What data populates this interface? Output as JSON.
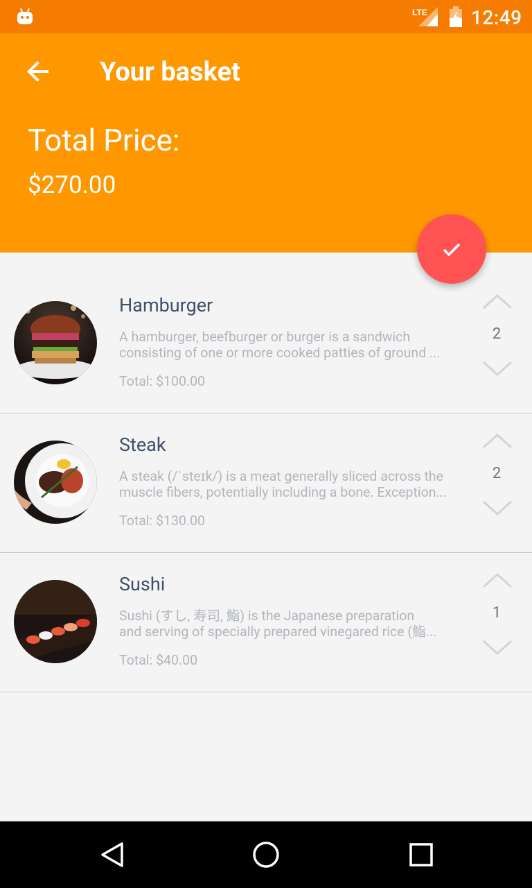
{
  "status_bar": {
    "time": "12:49",
    "network": "LTE",
    "icons": [
      "android-icon",
      "lte-signal-icon",
      "battery-icon"
    ]
  },
  "header": {
    "title": "Your basket",
    "total_label": "Total Price:",
    "total_value": "$270.00",
    "color": "#ff9800"
  },
  "fab": {
    "icon": "check-icon",
    "color": "#ff5252"
  },
  "items": [
    {
      "name": "Hamburger",
      "desc_line1": "A hamburger, beefburger or burger is a sandwich",
      "desc_line2": "consisting of one or more cooked patties of ground ...",
      "total": "Total: $100.00",
      "quantity": "2",
      "image": "hamburger-photo"
    },
    {
      "name": "Steak",
      "desc_line1": "A steak (/ˈsteɪk/) is a meat generally sliced across the",
      "desc_line2": "muscle fibers, potentially including a bone. Exception...",
      "total": "Total: $130.00",
      "quantity": "2",
      "image": "steak-photo"
    },
    {
      "name": "Sushi",
      "desc_line1": "Sushi (すし, 寿司, 鮨) is the Japanese preparation",
      "desc_line2": "and serving of specially prepared vinegared rice (鮨...",
      "total": "Total: $40.00",
      "quantity": "1",
      "image": "sushi-photo"
    }
  ],
  "nav": {
    "icons": [
      "back-triangle-icon",
      "home-circle-icon",
      "recents-square-icon"
    ]
  }
}
